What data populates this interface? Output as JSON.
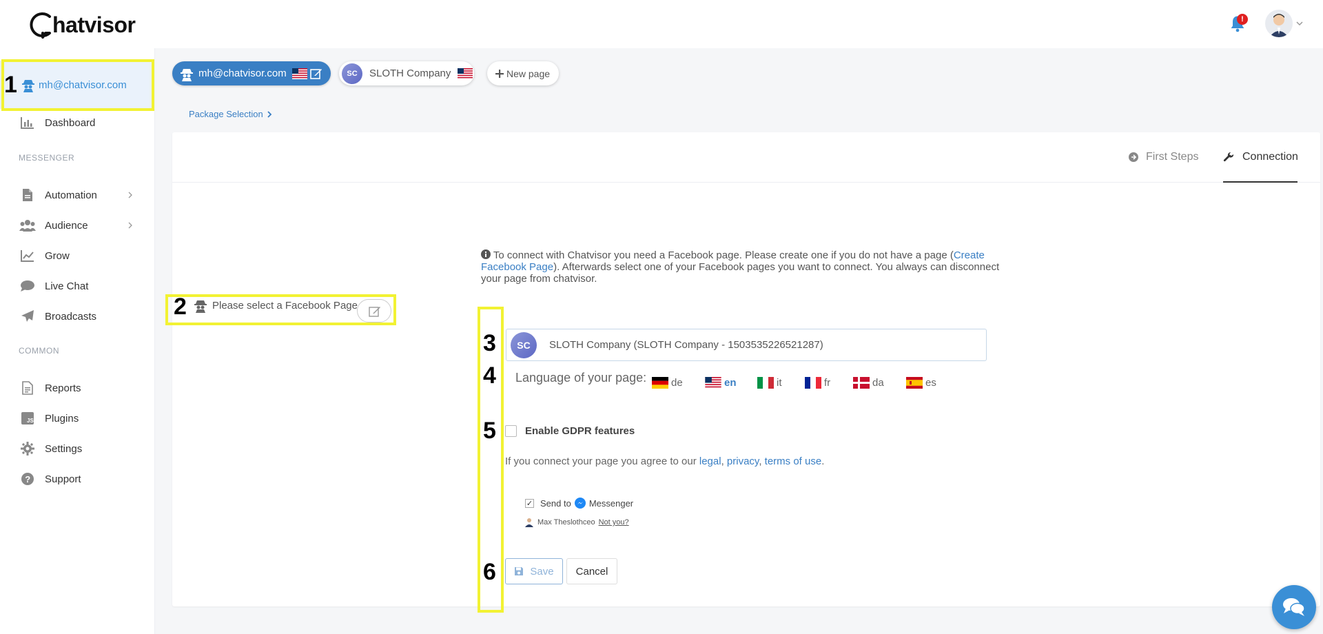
{
  "header": {
    "logo_text_before": "hatvisor",
    "notification_count": "!"
  },
  "sidebar": {
    "account_label": "mh@chatvisor.com",
    "items": [
      {
        "label": "Dashboard",
        "icon": "bar-chart-icon"
      },
      {
        "label": "Automation",
        "icon": "document-icon"
      },
      {
        "label": "Audience",
        "icon": "users-icon"
      },
      {
        "label": "Grow",
        "icon": "line-chart-icon"
      },
      {
        "label": "Live Chat",
        "icon": "chat-icon"
      },
      {
        "label": "Broadcasts",
        "icon": "paper-plane-icon"
      },
      {
        "label": "Reports",
        "icon": "report-icon"
      },
      {
        "label": "Plugins",
        "icon": "js-icon"
      },
      {
        "label": "Settings",
        "icon": "gear-icon"
      },
      {
        "label": "Support",
        "icon": "question-icon"
      }
    ],
    "sections": {
      "messenger": "MESSENGER",
      "common": "COMMON"
    }
  },
  "page_tabs": {
    "active": "mh@chatvisor.com",
    "company": "SLOTH Company",
    "new_page": "New page"
  },
  "breadcrumb": "Package Selection",
  "card_tabs": {
    "first_steps": "First Steps",
    "connection": "Connection"
  },
  "info": {
    "before_link": "To connect with Chatvisor you need a Facebook page. Please create one if you do not have a page (",
    "link": "Create Facebook Page",
    "after_link": "). Afterwards select one of your Facebook pages you want to connect. You always can disconnect your page from chatvisor."
  },
  "select_page_label": "Please select a Facebook Page",
  "page_select_value": "SLOTH Company (SLOTH Company - 1503535226521287)",
  "company_logo_text": "SC",
  "language": {
    "label": "Language of your page:",
    "options": [
      "de",
      "en",
      "it",
      "fr",
      "da",
      "es"
    ],
    "selected": "en"
  },
  "gdpr_label": "Enable GDPR features",
  "agree": {
    "text": "If you connect your page you agree to our ",
    "links": [
      "legal",
      "privacy",
      "terms of use"
    ],
    "sep": ", ",
    "end": "."
  },
  "send_to": {
    "before": "Send to",
    "after": "Messenger",
    "checked_mark": "✓"
  },
  "user_line": {
    "name": "Max Theslothceo",
    "not_you": "Not you?"
  },
  "buttons": {
    "save": "Save",
    "cancel": "Cancel"
  },
  "annotations": [
    "1",
    "2",
    "3",
    "4",
    "5",
    "6"
  ],
  "colors": {
    "accent": "#3a7fc4",
    "highlight": "#f2f233",
    "active_pill": "#3a7fc4"
  }
}
